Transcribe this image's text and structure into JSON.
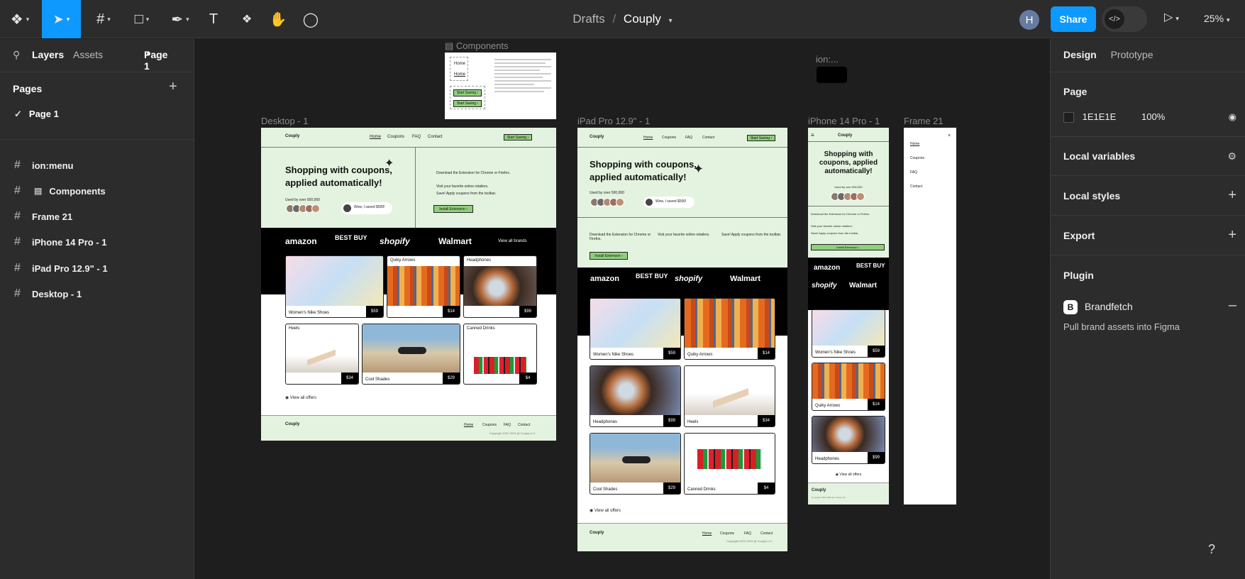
{
  "topbar": {
    "breadcrumb_parent": "Drafts",
    "breadcrumb_sep": "/",
    "file_name": "Couply",
    "avatar_initial": "H",
    "share_label": "Share",
    "zoom": "25%"
  },
  "left": {
    "tab_layers": "Layers",
    "tab_assets": "Assets",
    "page_selector": "Page 1",
    "pages_heading": "Pages",
    "current_page": "Page 1",
    "layers": [
      "ion:menu",
      "Components",
      "Frame 21",
      "iPhone 14 Pro - 1",
      "iPad Pro 12.9\" - 1",
      "Desktop - 1"
    ]
  },
  "right": {
    "tab_design": "Design",
    "tab_prototype": "Prototype",
    "page_heading": "Page",
    "bg_hex": "1E1E1E",
    "bg_opacity": "100%",
    "local_variables": "Local variables",
    "local_styles": "Local styles",
    "export": "Export",
    "plugin_heading": "Plugin",
    "plugin_name": "Brandfetch",
    "plugin_desc": "Pull brand assets into Figma"
  },
  "canvas": {
    "components_label": "Components",
    "ion_label": "ion:...",
    "desktop_label": "Desktop - 1",
    "ipad_label": "iPad Pro 12.9\" - 1",
    "iphone_label": "iPhone 14 Pro - 1",
    "frame21_label": "Frame 21",
    "site": {
      "logo": "Couply",
      "nav": [
        "Home",
        "Coupons",
        "FAQ",
        "Contact"
      ],
      "cta": "Start Saving ›",
      "hero_line1": "Shopping with coupons,",
      "hero_line2": "applied automatically!",
      "hero_m1": "Shopping with",
      "hero_m2": "coupons, applied",
      "hero_m3": "automatically!",
      "used_by": "Used by over 500,000",
      "review": "Wow, I saved $500!",
      "steps": [
        "Download the Extension for Chrome or Firefox.",
        "Visit your favorite online retailers.",
        "Save! Apply coupons from the toolbar."
      ],
      "install": "Install Extension ›",
      "brands": [
        "amazon",
        "BEST BUY",
        "shopify",
        "Walmart"
      ],
      "view_brands": "View all brands",
      "view_offers": "View all offers",
      "copyright": "Copyright 2022-2023 @ Couply LLC",
      "products": [
        {
          "name": "Women's Nike Shoes",
          "price": "$59",
          "label": ""
        },
        {
          "name": "",
          "price": "$14",
          "label": "Quiky Arrows"
        },
        {
          "name": "",
          "price": "$99",
          "label": "Headphones"
        },
        {
          "name": "",
          "price": "$34",
          "label": "Heels"
        },
        {
          "name": "Cool Shades",
          "price": "$29",
          "label": ""
        },
        {
          "name": "",
          "price": "$4",
          "label": "Canned Drinks"
        }
      ],
      "ipad_products": [
        {
          "name": "Women's Nike Shoes",
          "price": "$59"
        },
        {
          "name": "Quiky Arrows",
          "price": "$14"
        },
        {
          "name": "Headphones",
          "price": "$99"
        },
        {
          "name": "Heels",
          "price": "$34"
        },
        {
          "name": "Cool Shades",
          "price": "$29"
        },
        {
          "name": "Canned Drinks",
          "price": "$4"
        }
      ],
      "phone_products": [
        {
          "name": "Women's Nike Shoes",
          "price": "$59"
        },
        {
          "name": "Quiky Arrows",
          "price": "$14"
        },
        {
          "name": "Headphones",
          "price": "$99"
        }
      ]
    },
    "components": {
      "home": "Home",
      "start_saving": "Start Saving ›"
    }
  },
  "colors": {
    "accent": "#0d99ff",
    "mint": "#e4f3df",
    "panel": "#2c2c2c",
    "canvas": "#1e1e1e"
  },
  "icons": [
    "figma-menu-icon",
    "move-icon",
    "frame-icon",
    "rectangle-icon",
    "pen-icon",
    "text-icon",
    "components-icon",
    "hand-icon",
    "comment-icon",
    "search-icon",
    "eye-icon",
    "plus-icon",
    "minus-icon",
    "help-icon"
  ]
}
